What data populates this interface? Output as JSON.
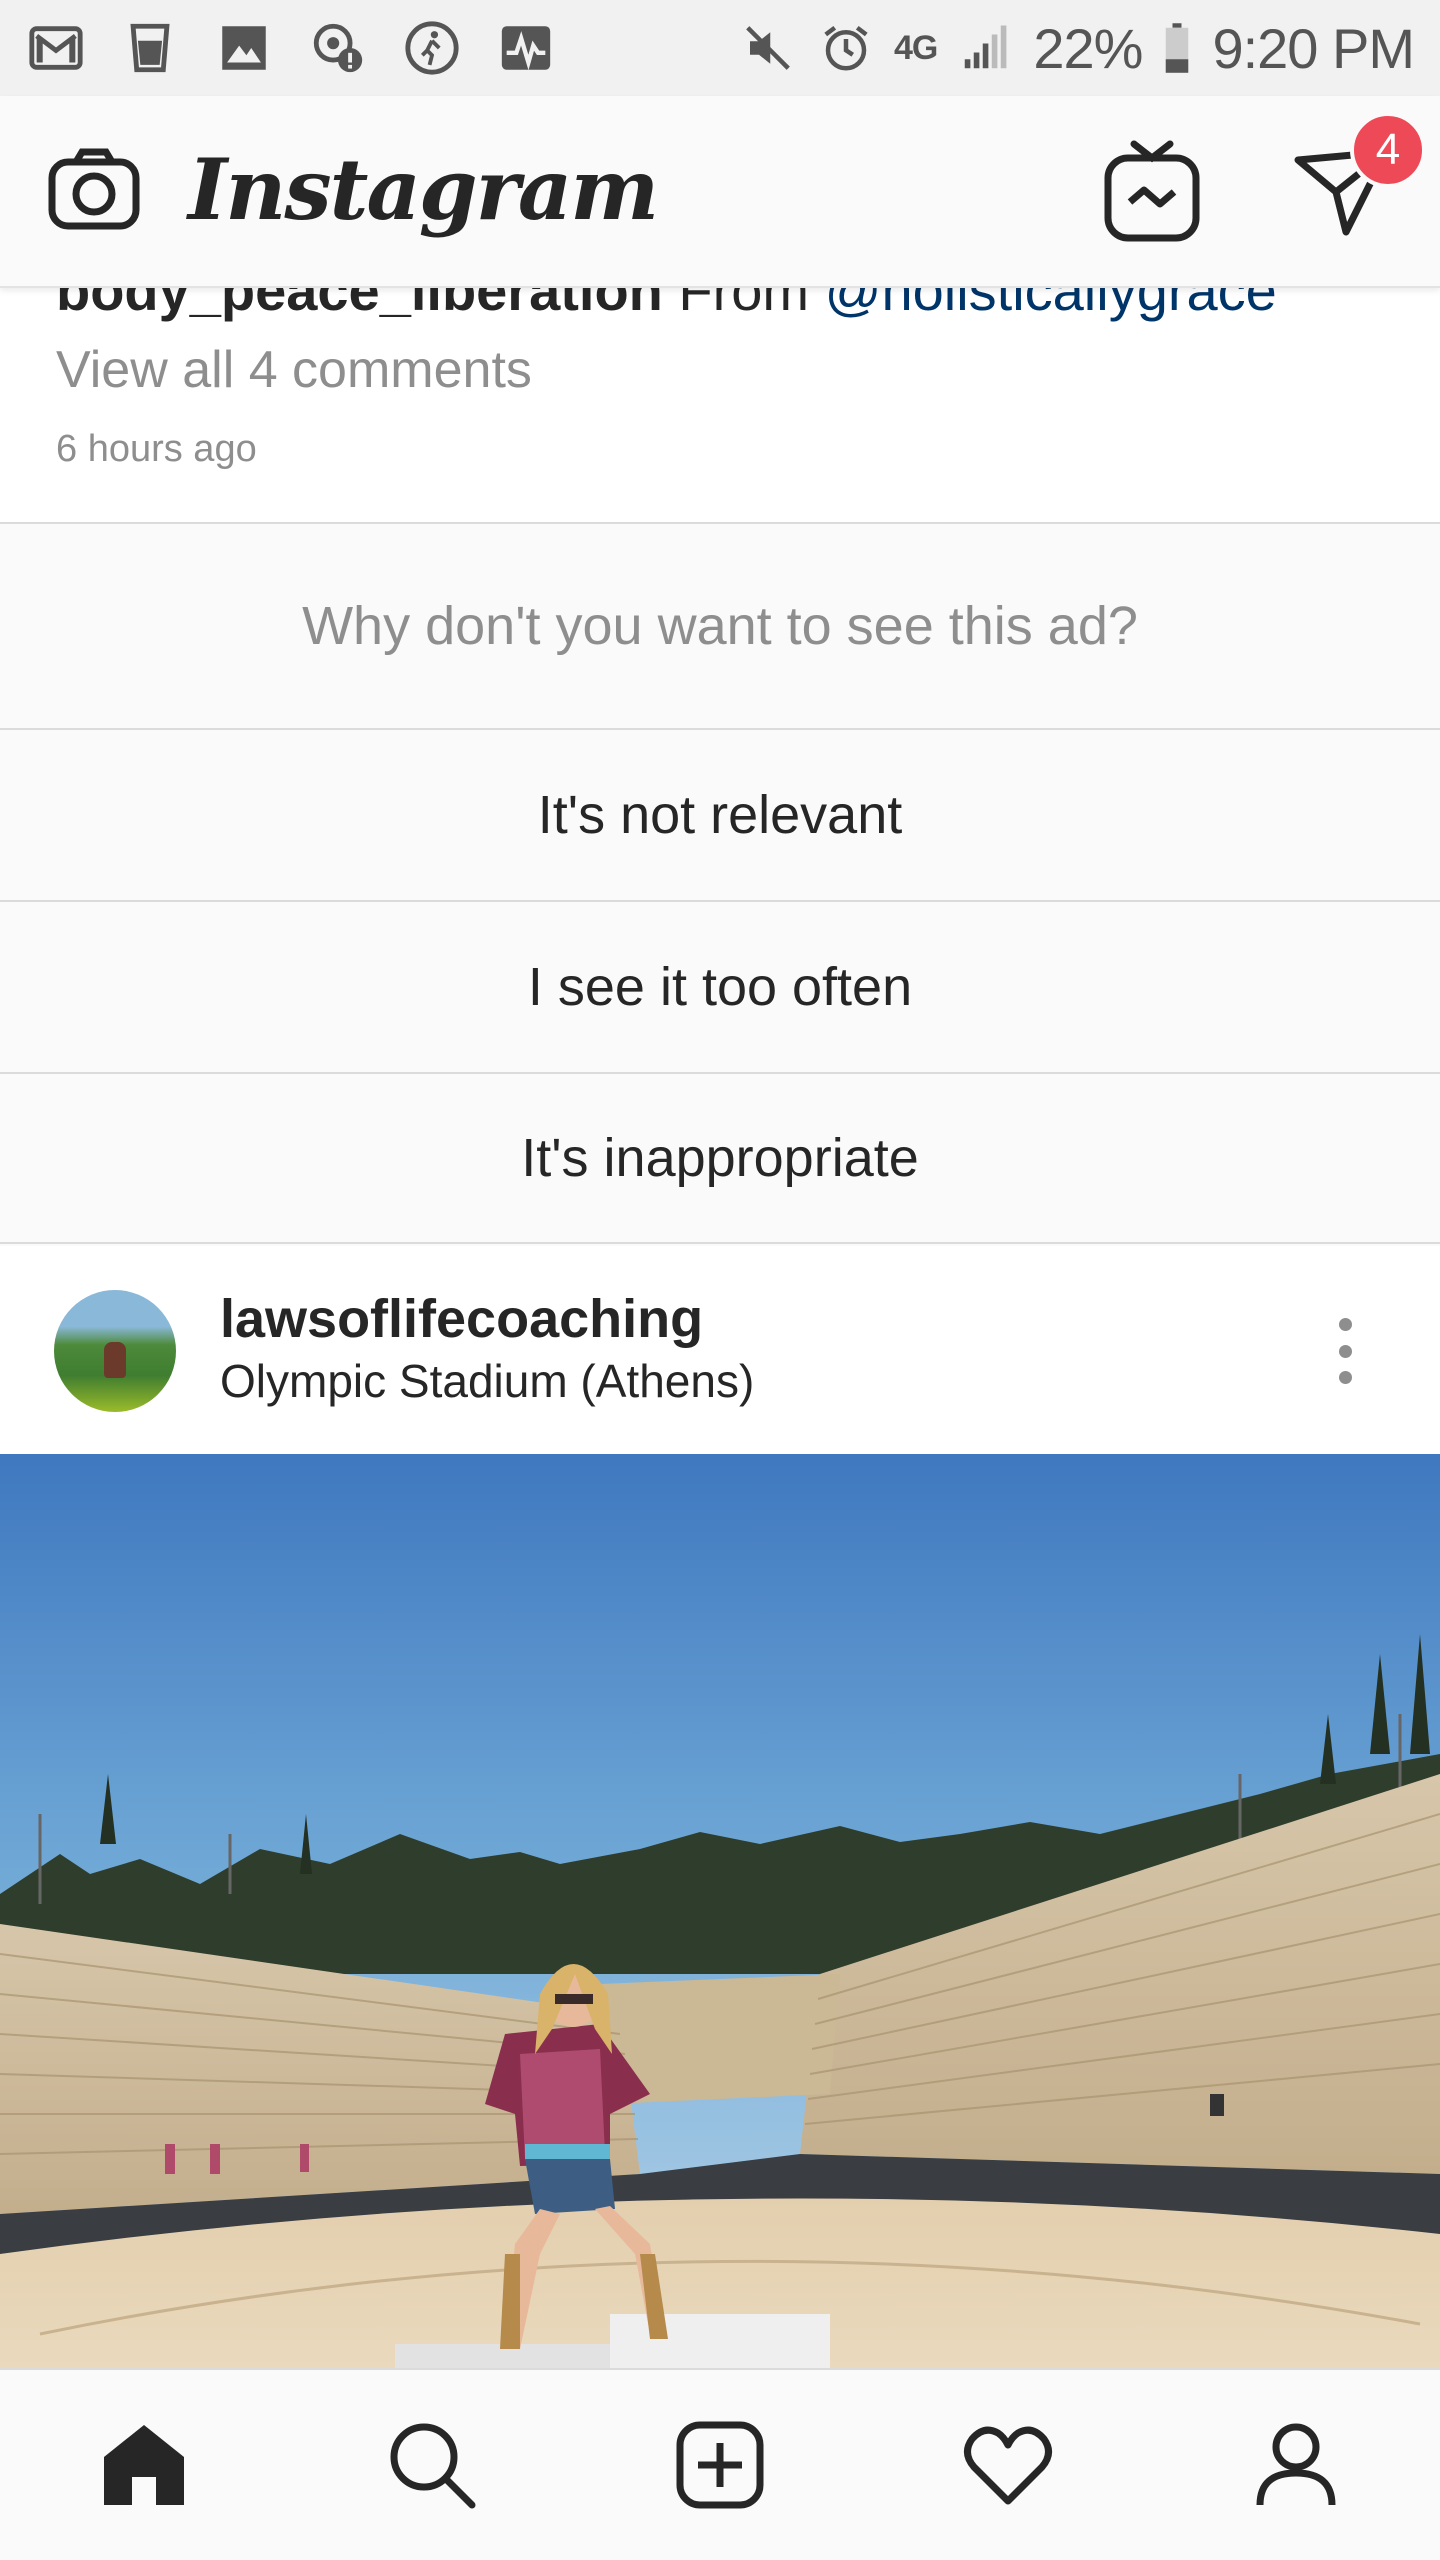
{
  "status_bar": {
    "battery": "22%",
    "time": "9:20 PM",
    "network": "4G",
    "icons": [
      "gmail-icon",
      "cup-icon",
      "gallery-icon",
      "location-alert-icon",
      "walking-icon",
      "pulse-icon",
      "mute-icon",
      "alarm-icon",
      "signal-icon",
      "battery-icon"
    ]
  },
  "header": {
    "logo_text": "Instagram",
    "direct_badge": "4",
    "icons": [
      "camera-icon",
      "igtv-icon",
      "direct-icon"
    ]
  },
  "previous_post": {
    "caption_user": "body_peace_liberation",
    "caption_text": " From ",
    "caption_mention": "@holisticallygrace",
    "view_comments": "View all 4 comments",
    "time_ago": "6 hours ago"
  },
  "hide_ad_menu": {
    "question": "Why don't you want to see this ad?",
    "options": [
      "It's not relevant",
      "I see it too often",
      "It's inappropriate"
    ]
  },
  "post": {
    "username": "lawsoflifecoaching",
    "location": "Olympic Stadium (Athens)"
  },
  "bottom_nav": {
    "items": [
      "home-icon",
      "search-icon",
      "new-post-icon",
      "activity-icon",
      "profile-icon"
    ]
  },
  "colors": {
    "badge": "#ed4956",
    "mention": "#003569",
    "muted_text": "#8e8e8e",
    "primary_text": "#262626"
  }
}
